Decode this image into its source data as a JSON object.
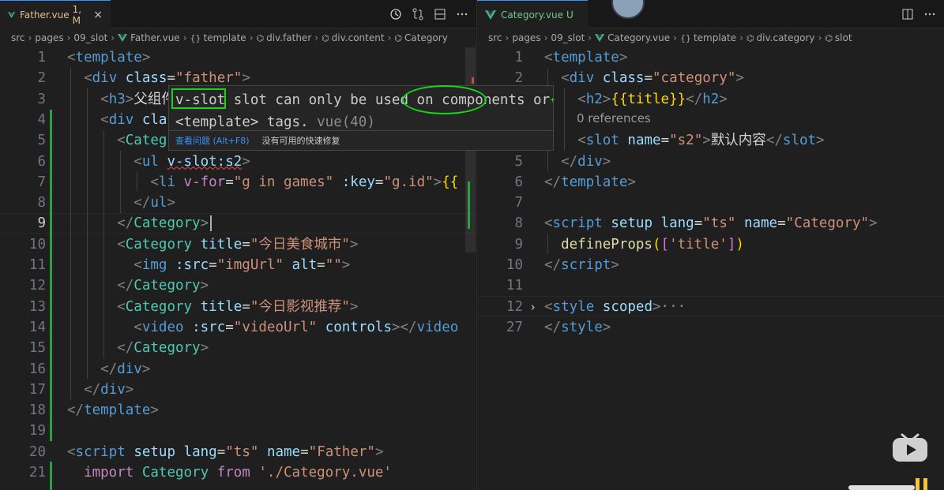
{
  "left_tab": {
    "title": "Father.vue",
    "status": "1, M",
    "close": "×"
  },
  "right_tab": {
    "title": "Category.vue",
    "status": "U"
  },
  "left_breadcrumb": [
    "src",
    "pages",
    "09_slot",
    "Father.vue",
    "template",
    "div.father",
    "div.content",
    "Category"
  ],
  "right_breadcrumb": [
    "src",
    "pages",
    "09_slot",
    "Category.vue",
    "template",
    "div.category",
    "slot"
  ],
  "hover": {
    "message_pre": " slot can only be used on ",
    "message_highlight_1": "v-slot",
    "message_highlight_2": "components",
    "message_post": " or",
    "message_line2": "<template> tags.",
    "source": "vue(40)",
    "view_problem": "查看问题 (Alt+F8)",
    "no_quick_fix": "没有可用的快速修复",
    "plus": "+"
  },
  "codelens": "0 references",
  "left_lines": {
    "n1": "1",
    "n2": "2",
    "n3": "3",
    "n4": "4",
    "n5": "5",
    "n6": "6",
    "n7": "7",
    "n8": "8",
    "n9": "9",
    "n10": "10",
    "n11": "11",
    "n12": "12",
    "n13": "13",
    "n14": "14",
    "n15": "15",
    "n16": "16",
    "n17": "17",
    "n18": "18",
    "n19": "19",
    "n20": "20",
    "n21": "21",
    "l3_text": "父组件",
    "l4_attr": "cla",
    "l5_tag": "Categ",
    "l6_dir": "v-slot:s2",
    "l7_a": "v-for",
    "l7_b": "\"g in games\"",
    "l7_c": ":key",
    "l7_d": "\"g.id\"",
    "l7_e": "{{",
    "l10_title": "\"今日美食城市\"",
    "l11_src": "\"imgUrl\"",
    "l11_alt": "\"\"",
    "l13_title": "\"今日影视推荐\"",
    "l14_src": "\"videoUrl\"",
    "l20_lang": "\"ts\"",
    "l20_name": "\"Father\"",
    "l21_from": "'./Category.vue'"
  },
  "right_lines": {
    "n1": "1",
    "n2": "2",
    "n3": "3",
    "n4": "4",
    "n5": "5",
    "n6": "6",
    "n7": "7",
    "n8": "8",
    "n9": "9",
    "n10": "10",
    "n11": "11",
    "n12": "12",
    "n27": "27",
    "l2_class": "\"category\"",
    "l3_expr": "{{title}}",
    "l4_name": "\"s2\"",
    "l4_text": "默认内容",
    "l8_lang": "\"ts\"",
    "l8_name": "\"Category\"",
    "l9_fn": "defineProps",
    "l9_arg": "'title'",
    "l12_fold": "···"
  },
  "colors": {
    "accent": "#3794ff",
    "annotation": "#18d518",
    "modified": "#e2c08d",
    "untracked": "#73c991"
  }
}
